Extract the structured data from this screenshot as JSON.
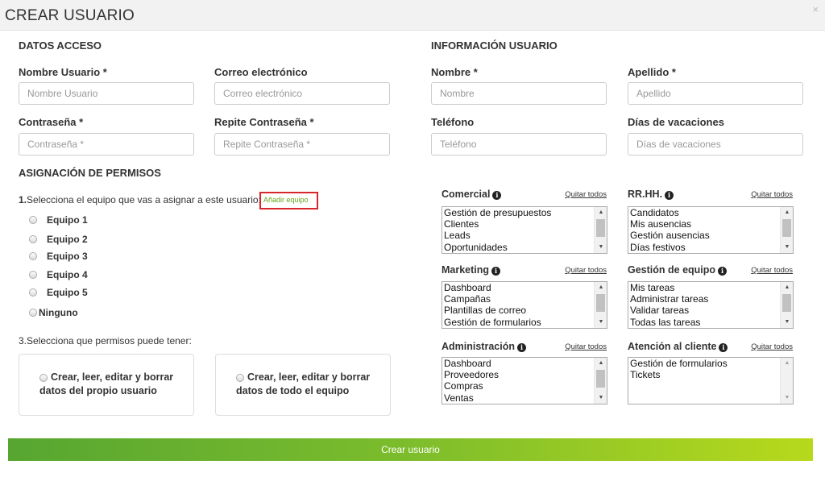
{
  "modal": {
    "title": "CREAR USUARIO",
    "close_glyph": "×"
  },
  "access": {
    "title": "DATOS ACCESO",
    "username": {
      "label": "Nombre Usuario *",
      "placeholder": "Nombre Usuario"
    },
    "email": {
      "label": "Correo electrónico",
      "placeholder": "Correo electrónico"
    },
    "password": {
      "label": "Contraseña *",
      "placeholder": "Contraseña *"
    },
    "password_repeat": {
      "label": "Repite Contraseña *",
      "placeholder": "Repite Contraseña *"
    }
  },
  "user_info": {
    "title": "INFORMACIÓN USUARIO",
    "first_name": {
      "label": "Nombre *",
      "placeholder": "Nombre"
    },
    "last_name": {
      "label": "Apellido *",
      "placeholder": "Apellido"
    },
    "phone": {
      "label": "Teléfono",
      "placeholder": "Teléfono"
    },
    "vacation_days": {
      "label": "Días de vacaciones",
      "placeholder": "Días de vacaciones"
    }
  },
  "permissions": {
    "title": "ASIGNACIÓN DE PERMISOS",
    "step1_number": "1.",
    "step1_text": "Selecciona el equipo que vas a asignar a este usuario:",
    "add_team": "Añadir equipo",
    "teams": [
      "Equipo 1",
      "Equipo 2",
      "Equipo 3",
      "Equipo 4",
      "Equipo 5",
      "Ninguno"
    ],
    "step3_text": "3.Selecciona que permisos puede tener:",
    "options": [
      "Crear, leer, editar y borrar datos del propio usuario",
      "Crear, leer, editar y borrar datos de todo el equipo"
    ]
  },
  "modules": {
    "remove_all_label": "Quitar todos",
    "lists": [
      {
        "title": "Comercial",
        "items": [
          "Gestión de presupuestos",
          "Clientes",
          "Leads",
          "Oportunidades"
        ]
      },
      {
        "title": "RR.HH.",
        "items": [
          "Candidatos",
          "Mis ausencias",
          "Gestión ausencias",
          "Días festivos"
        ]
      },
      {
        "title": "Marketing",
        "items": [
          "Dashboard",
          "Campañas",
          "Plantillas de correo",
          "Gestión de formularios"
        ]
      },
      {
        "title": "Gestión de equipo",
        "items": [
          "Mis tareas",
          "Administrar tareas",
          "Validar tareas",
          "Todas las tareas"
        ]
      },
      {
        "title": "Administración",
        "items": [
          "Dashboard",
          "Proveedores",
          "Compras",
          "Ventas"
        ]
      },
      {
        "title": "Atención al cliente",
        "items": [
          "Gestión de formularios",
          "Tickets"
        ]
      }
    ]
  },
  "submit": {
    "label": "Crear usuario"
  },
  "colors": {
    "accent_green_start": "#57a631",
    "accent_green_end": "#b7d91c",
    "highlight_red": "#d9262c",
    "link_green": "#67a51a"
  },
  "icons": {
    "info": "info-circle-icon",
    "close": "close-icon"
  }
}
